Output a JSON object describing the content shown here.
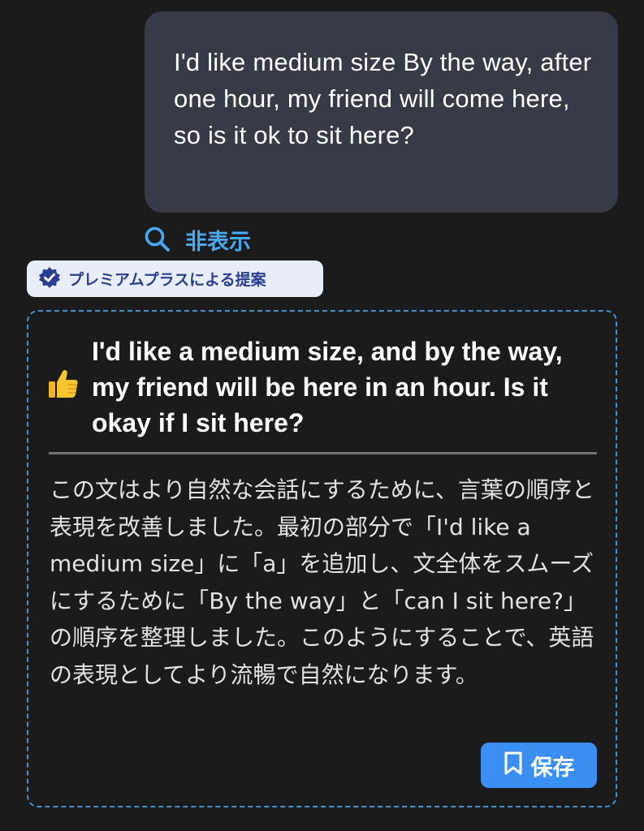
{
  "user_message": {
    "text": "I'd like medium size By the way, after one hour, my friend will come here, so is it ok to sit here?"
  },
  "hide_toggle": {
    "icon": "search-icon",
    "label": "非表示",
    "color": "#4aa8f0"
  },
  "badge": {
    "icon": "verified-badge-icon",
    "label": "プレミアムプラスによる提案"
  },
  "suggestion": {
    "icon": "thumbs-up-icon",
    "corrected_text": "I'd like a medium size, and by the way, my friend will be here in an hour. Is it okay if I sit here?",
    "explanation": "この文はより自然な会話にするために、言葉の順序と表現を改善しました。最初の部分で「I'd like a medium size」に「a」を追加し、文全体をスムーズにするために「By the way」と「can I sit here?」の順序を整理しました。このようにすることで、英語の表現としてより流暢で自然になります。",
    "save_button": {
      "icon": "bookmark-icon",
      "label": "保存"
    }
  },
  "colors": {
    "background": "#1b1b1c",
    "user_bubble": "#383a45",
    "accent": "#3b8ff2",
    "card_border": "#3f91cf",
    "badge_bg": "#e7edf9",
    "badge_text": "#2c3e8f"
  }
}
